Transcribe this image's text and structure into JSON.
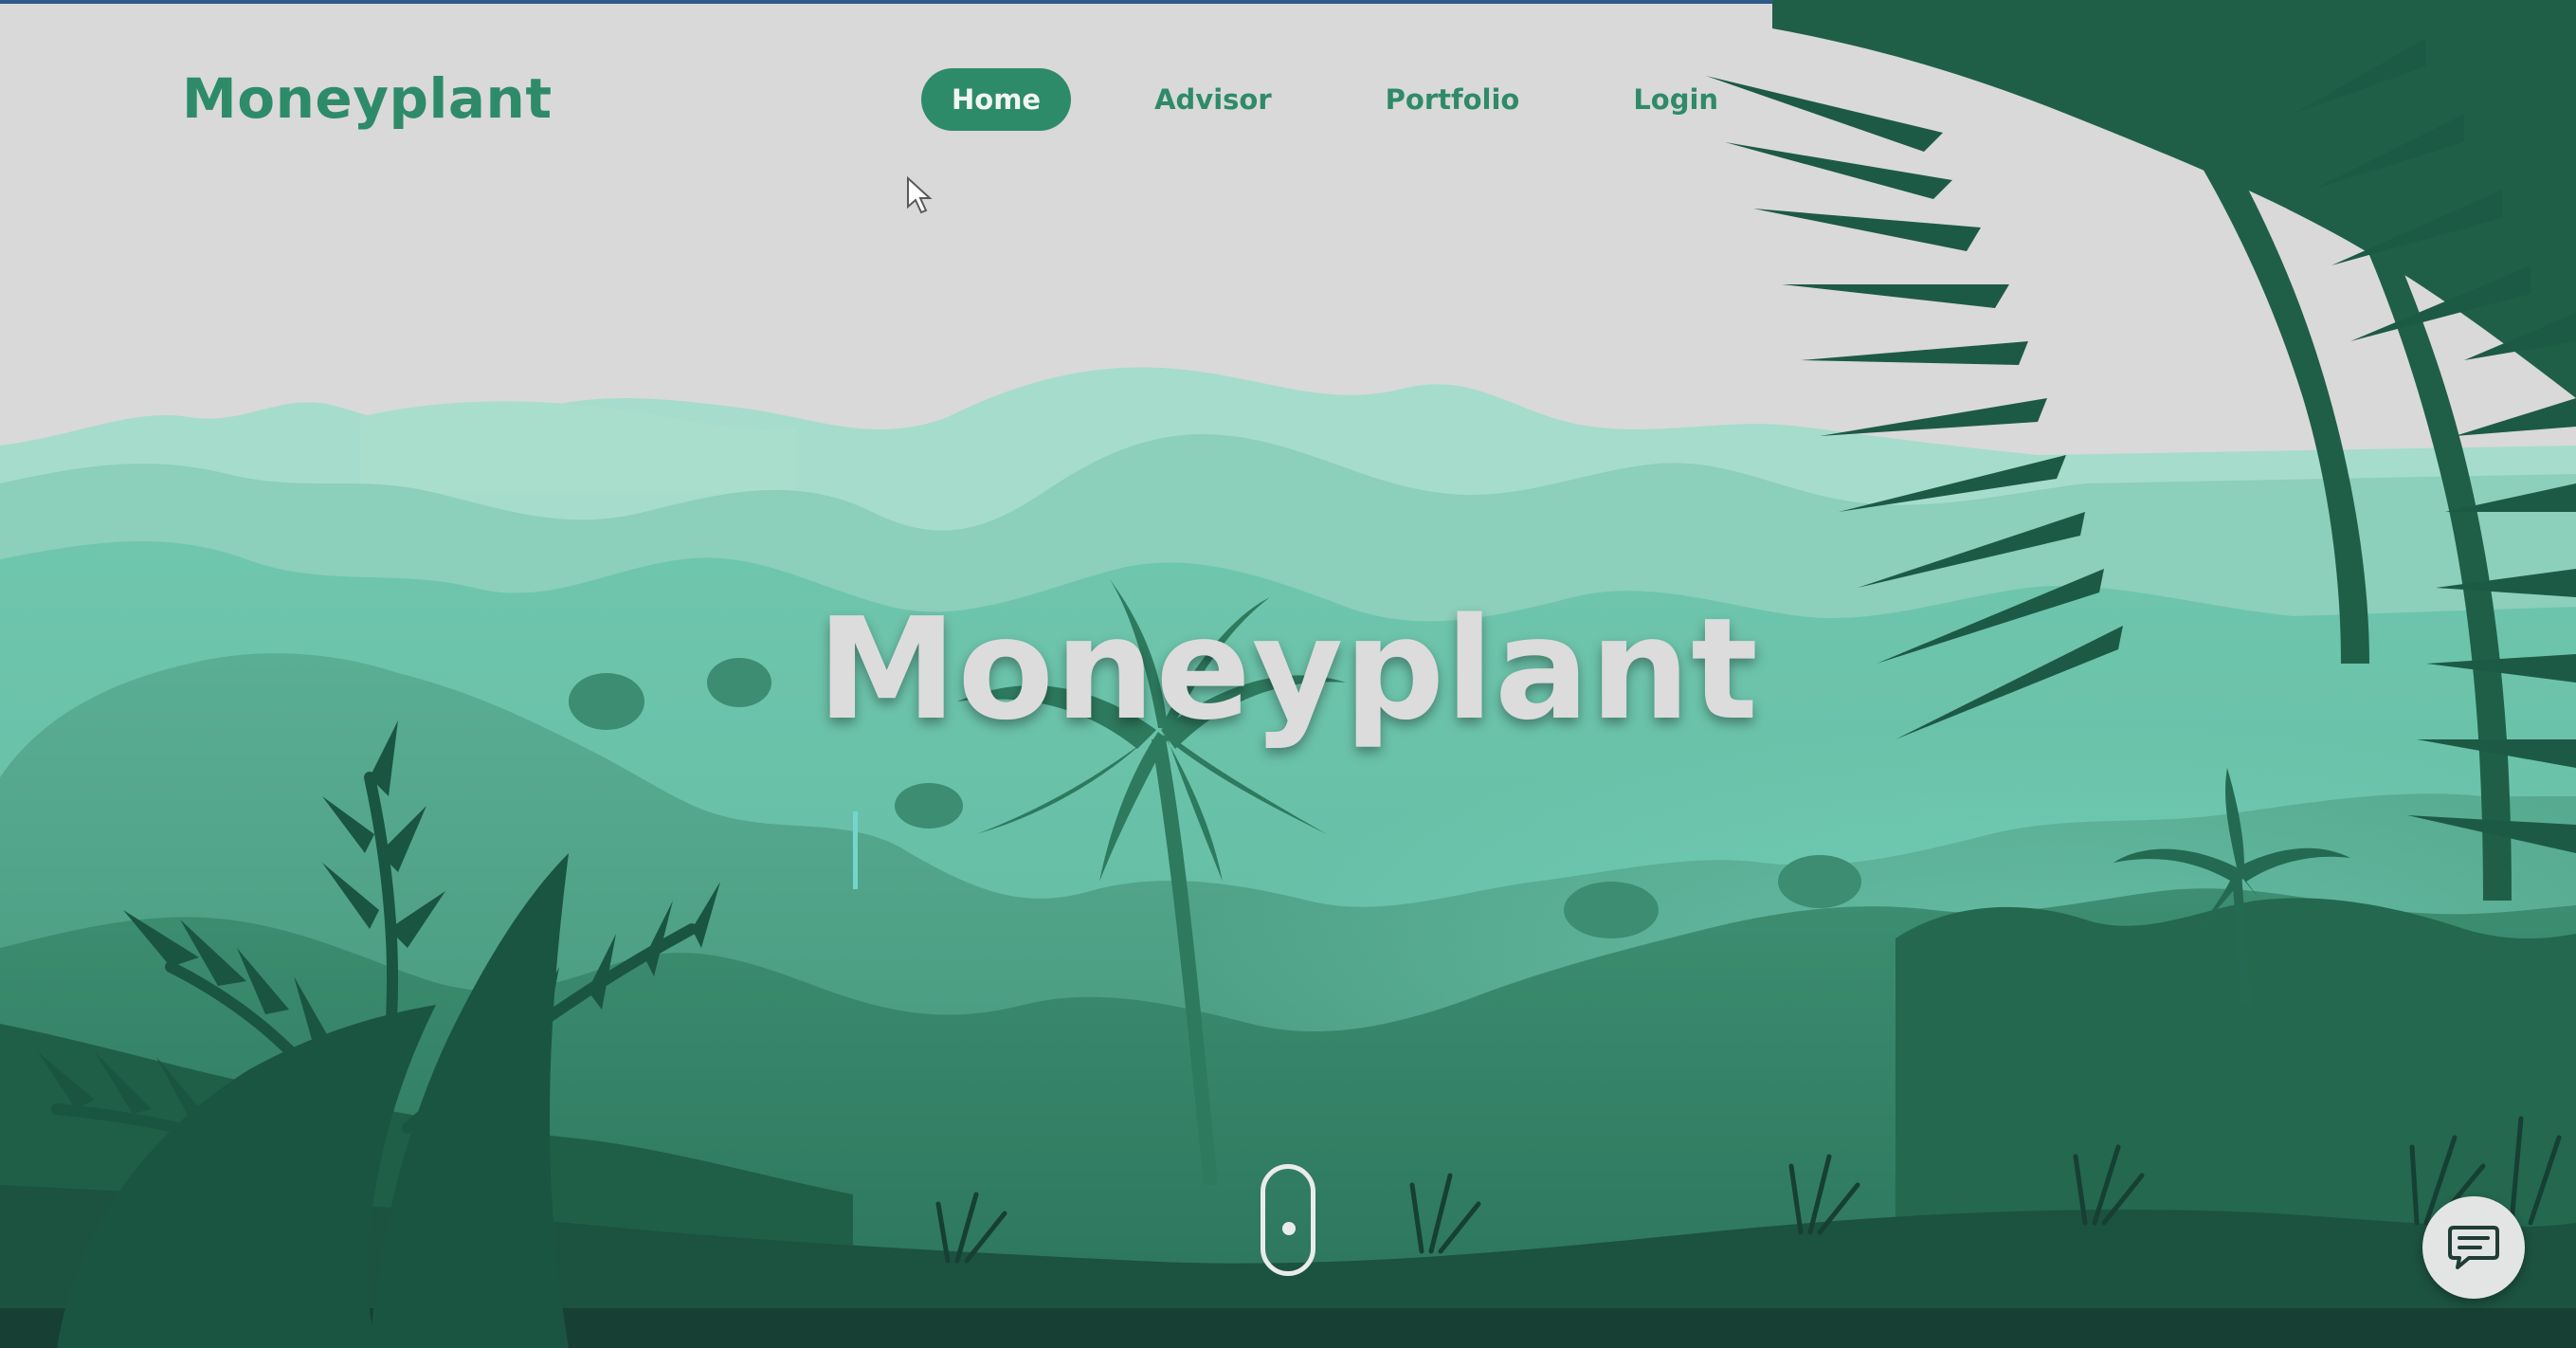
{
  "header": {
    "logo": "Moneyplant"
  },
  "nav": {
    "items": [
      {
        "label": "Home",
        "active": true
      },
      {
        "label": "Advisor",
        "active": false
      },
      {
        "label": "Portfolio",
        "active": false
      },
      {
        "label": "Login",
        "active": false
      }
    ]
  },
  "hero": {
    "title": "Moneyplant"
  },
  "icons": {
    "scroll": "scroll-mouse-icon",
    "chat": "chat-bubble-icon",
    "cursor": "mouse-pointer-icon"
  },
  "colors": {
    "brand": "#2e8b6a",
    "sky": "#d9d9d9",
    "foreground_dark": "#1f5a44"
  }
}
